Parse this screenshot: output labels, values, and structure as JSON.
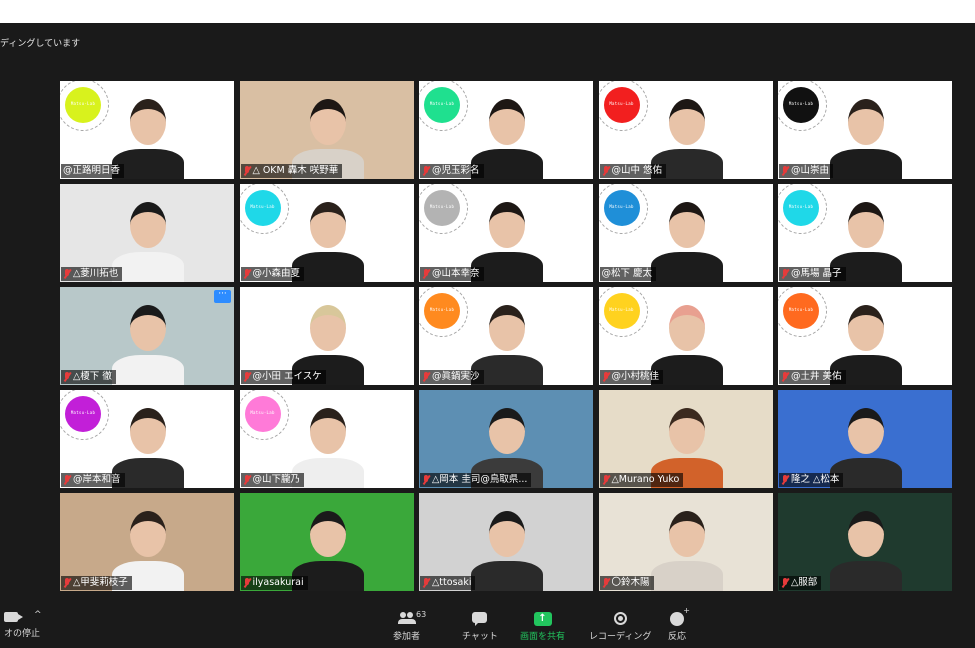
{
  "recording_banner": "ディングしています",
  "tiles": [
    {
      "name": "@正路明日香",
      "muted": false,
      "active": true,
      "sun": "#d8f21d",
      "bg": "#ffffff",
      "hair": "#2a211b",
      "shirt": "#1f1f1f"
    },
    {
      "name": "△ OKM 轟木 咲野華",
      "muted": true,
      "active": false,
      "sun": "",
      "bg": "#d9bfa3",
      "hair": "#1d1714",
      "shirt": "#d8d1c8"
    },
    {
      "name": "@児玉彩名",
      "muted": true,
      "active": false,
      "sun": "#1fe08f",
      "bg": "#ffffff",
      "hair": "#1d1714",
      "shirt": "#1c1c1c"
    },
    {
      "name": "@山中 悠佑",
      "muted": true,
      "active": false,
      "sun": "#f21f1f",
      "bg": "#ffffff",
      "hair": "#1d1714",
      "shirt": "#292929"
    },
    {
      "name": "@山崇由",
      "muted": true,
      "active": false,
      "sun": "#111111",
      "bg": "#ffffff",
      "hair": "#2a211b",
      "shirt": "#1c1c1c"
    },
    {
      "name": "△菱川拓也",
      "muted": true,
      "active": false,
      "sun": "",
      "bg": "#e6e6e6",
      "hair": "#1a1a1a",
      "shirt": "#f2f2f2"
    },
    {
      "name": "@小森由夏",
      "muted": true,
      "active": false,
      "sun": "#1fd8e8",
      "bg": "#ffffff",
      "hair": "#2a211b",
      "shirt": "#1c1c1c"
    },
    {
      "name": "@山本幸奈",
      "muted": true,
      "active": false,
      "sun": "#b3b3b3",
      "bg": "#ffffff",
      "hair": "#1d1714",
      "shirt": "#1c1c1c"
    },
    {
      "name": "@松下 慶太",
      "muted": false,
      "active": false,
      "sun": "#1f8fd8",
      "bg": "#ffffff",
      "hair": "#1d1714",
      "shirt": "#1c1c1c"
    },
    {
      "name": "@馬場 晶子",
      "muted": true,
      "active": false,
      "sun": "#1fd8e8",
      "bg": "#ffffff",
      "hair": "#1d1714",
      "shirt": "#1c1c1c"
    },
    {
      "name": "△榎下 徹",
      "muted": true,
      "active": false,
      "sun": "",
      "bg": "#b8c8c9",
      "hair": "#1a1a1a",
      "shirt": "#f2f2f2",
      "more": true
    },
    {
      "name": "@小田 エイスケ",
      "muted": true,
      "active": false,
      "sun": "",
      "bg": "#ffffff",
      "hair": "#d8c79a",
      "shirt": "#1c1c1c"
    },
    {
      "name": "@眞鍋実沙",
      "muted": true,
      "active": false,
      "sun": "#ff8a1f",
      "bg": "#ffffff",
      "hair": "#2a211b",
      "shirt": "#2a2a2a"
    },
    {
      "name": "@小村桃佳",
      "muted": true,
      "active": false,
      "sun": "#ffd21f",
      "bg": "#ffffff",
      "hair": "#e8a090",
      "shirt": "#1c1c1c"
    },
    {
      "name": "@土井 美佑",
      "muted": true,
      "active": false,
      "sun": "#ff6a1f",
      "bg": "#ffffff",
      "hair": "#2a211b",
      "shirt": "#1c1c1c"
    },
    {
      "name": "@岸本和音",
      "muted": true,
      "active": false,
      "sun": "#c21fd8",
      "bg": "#ffffff",
      "hair": "#2a211b",
      "shirt": "#2a2a2a"
    },
    {
      "name": "@山下朧乃",
      "muted": true,
      "active": false,
      "sun": "#ff7ad8",
      "bg": "#ffffff",
      "hair": "#2a211b",
      "shirt": "#eeeeee"
    },
    {
      "name": "△岡本 圭司@鳥取県...",
      "muted": true,
      "active": false,
      "sun": "",
      "bg": "#5d8fb3",
      "hair": "#1a1a1a",
      "shirt": "#3b3b3b"
    },
    {
      "name": "△Murano Yuko",
      "muted": true,
      "active": false,
      "sun": "",
      "bg": "#e6dcc8",
      "hair": "#3b2a1f",
      "shirt": "#d2622a"
    },
    {
      "name": "隆之 △松本",
      "muted": true,
      "active": false,
      "sun": "",
      "bg": "#3a6fd0",
      "hair": "#1a1a1a",
      "shirt": "#2a2a2a"
    },
    {
      "name": "△甲斐莉枝子",
      "muted": true,
      "active": false,
      "sun": "",
      "bg": "#c7a98a",
      "hair": "#2a211b",
      "shirt": "#f2f2f2"
    },
    {
      "name": "ilyasakurai",
      "muted": true,
      "active": false,
      "sun": "",
      "bg": "#3aa83a",
      "hair": "#1a1a1a",
      "shirt": "#1c1c1c"
    },
    {
      "name": "△ttosaki",
      "muted": true,
      "active": false,
      "sun": "",
      "bg": "#d2d2d2",
      "hair": "#1a1a1a",
      "shirt": "#2a2a2a"
    },
    {
      "name": "〇鈴木陽",
      "muted": true,
      "active": false,
      "sun": "",
      "bg": "#e8e2d6",
      "hair": "#2a211b",
      "shirt": "#d8d1c8"
    },
    {
      "name": "△服部",
      "muted": true,
      "active": false,
      "sun": "",
      "bg": "#1f3a2e",
      "hair": "#1a1a1a",
      "shirt": "#2a2a2a"
    }
  ],
  "sun_logo_text": "Matsu-Lab",
  "more_label": "···",
  "toolbar": {
    "video_label": "オの停止",
    "participants_label": "参加者",
    "participants_count": "63",
    "chat_label": "チャット",
    "share_label": "画面を共有",
    "share_glyph": "↑",
    "record_label": "レコーディング",
    "reactions_label": "反応",
    "chevron": "^"
  }
}
